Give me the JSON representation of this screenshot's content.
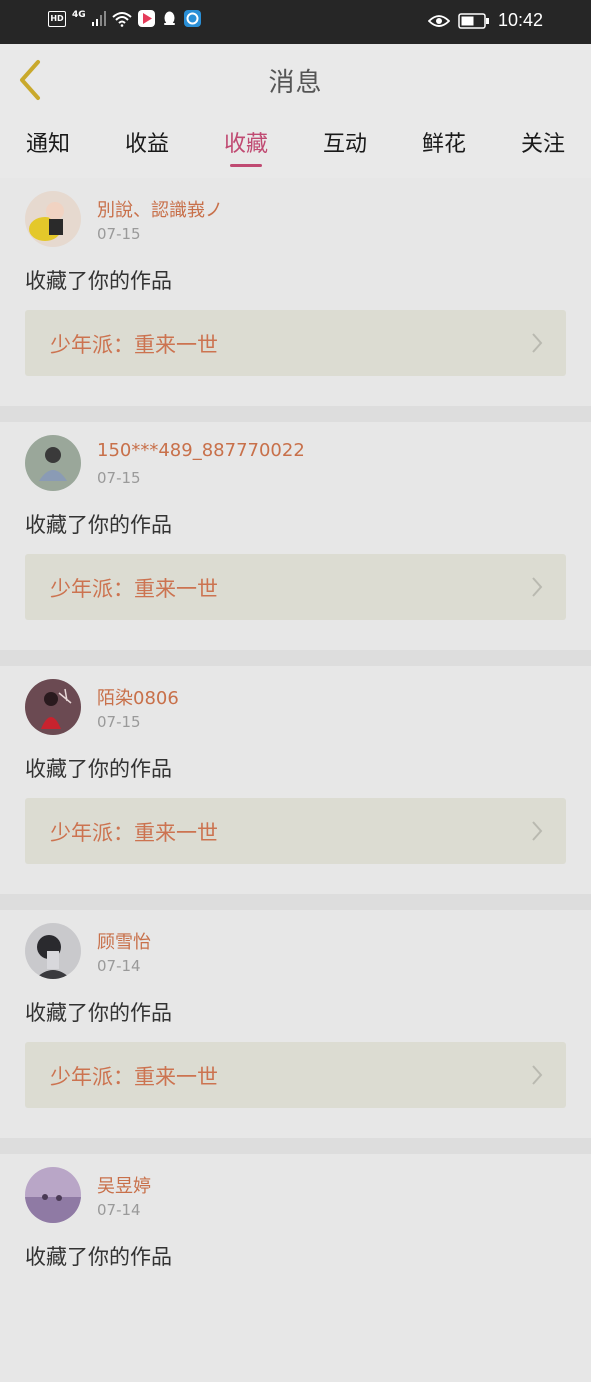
{
  "status_bar": {
    "hd": "HD",
    "network": "4G",
    "time": "10:42"
  },
  "header": {
    "title": "消息"
  },
  "tabs": [
    {
      "label": "通知"
    },
    {
      "label": "收益"
    },
    {
      "label": "收藏",
      "active": true
    },
    {
      "label": "互动"
    },
    {
      "label": "鲜花"
    },
    {
      "label": "关注"
    }
  ],
  "messages": [
    {
      "username": "別說、認識峩ノ",
      "date": "07-15",
      "action": "收藏了你的作品",
      "work": "少年派：重来一世"
    },
    {
      "username": "150***489_887770022",
      "date": "07-15",
      "action": "收藏了你的作品",
      "work": "少年派：重来一世"
    },
    {
      "username": "陌染0806",
      "date": "07-15",
      "action": "收藏了你的作品",
      "work": "少年派：重来一世"
    },
    {
      "username": "顾雪怡",
      "date": "07-14",
      "action": "收藏了你的作品",
      "work": "少年派：重来一世"
    },
    {
      "username": "吴昱婷",
      "date": "07-14",
      "action": "收藏了你的作品",
      "work": ""
    }
  ],
  "colors": {
    "accent": "#c04a72",
    "username": "#c8704a",
    "work_title": "#cc7350"
  }
}
